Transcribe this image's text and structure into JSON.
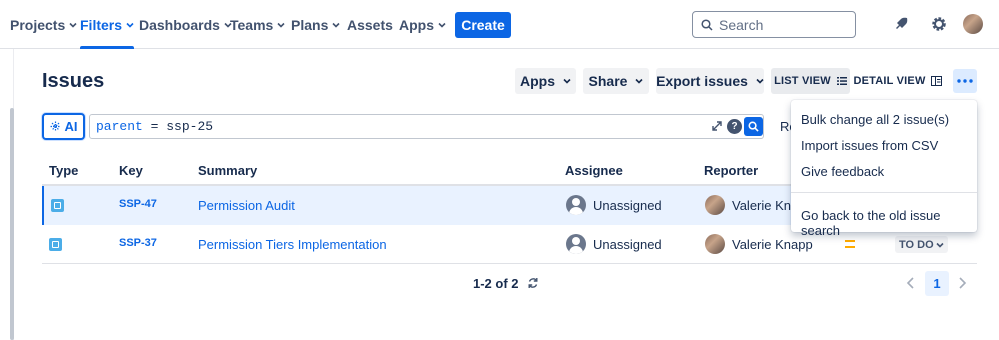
{
  "nav": {
    "items": [
      {
        "label": "Projects",
        "has_dropdown": true
      },
      {
        "label": "Filters",
        "has_dropdown": true,
        "active": true
      },
      {
        "label": "Dashboards",
        "has_dropdown": true
      },
      {
        "label": "Teams",
        "has_dropdown": true
      },
      {
        "label": "Plans",
        "has_dropdown": true
      },
      {
        "label": "Assets",
        "has_dropdown": false
      },
      {
        "label": "Apps",
        "has_dropdown": true
      }
    ],
    "create_label": "Create",
    "search_placeholder": "Search",
    "icons": [
      "notifications-icon",
      "help-icon",
      "settings-icon",
      "profile-avatar"
    ]
  },
  "page": {
    "title": "Issues"
  },
  "toolbar": {
    "apps_label": "Apps",
    "share_label": "Share",
    "export_label": "Export issues",
    "list_view_label": "LIST VIEW",
    "detail_view_label": "DETAIL VIEW",
    "selected_view": "LIST VIEW"
  },
  "query": {
    "ai_label": "AI",
    "jql_field": "parent",
    "jql_operator": "=",
    "jql_value": "ssp-25",
    "reset_partial": "Re"
  },
  "table": {
    "columns": [
      "Type",
      "Key",
      "Summary",
      "Assignee",
      "Reporter"
    ],
    "rows": [
      {
        "type": "subtask",
        "key": "SSP-47",
        "summary": "Permission Audit",
        "assignee": "Unassigned",
        "reporter": "Valerie Knapp",
        "reporter_visible": "Valerie Kna",
        "selected": true
      },
      {
        "type": "subtask",
        "key": "SSP-37",
        "summary": "Permission Tiers Implementation",
        "assignee": "Unassigned",
        "reporter": "Valerie Knapp",
        "reporter_visible": "Valerie Knapp",
        "priority": "medium",
        "status": "TO DO",
        "selected": false
      }
    ]
  },
  "pagination": {
    "summary": "1-2 of 2",
    "current_page": "1"
  },
  "menu": {
    "items": [
      "Bulk change all 2 issue(s)",
      "Import issues from CSV",
      "Give feedback",
      "Go back to the old issue search"
    ]
  },
  "colors": {
    "accent": "#0c66e4",
    "selected_row": "#e9f2ff",
    "text": "#172b4d",
    "priority_medium": "#ffab00"
  }
}
